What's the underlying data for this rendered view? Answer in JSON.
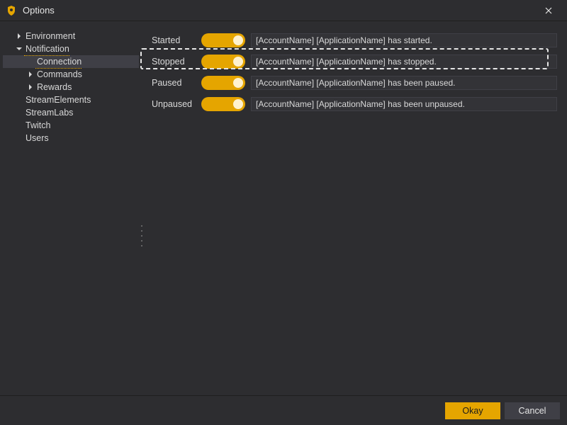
{
  "window": {
    "title": "Options"
  },
  "tree": {
    "environment": "Environment",
    "notification": "Notification",
    "connection": "Connection",
    "commands": "Commands",
    "rewards": "Rewards",
    "streamelements": "StreamElements",
    "streamlabs": "StreamLabs",
    "twitch": "Twitch",
    "users": "Users"
  },
  "rows": [
    {
      "label": "Started",
      "enabled": true,
      "text": "[AccountName] [ApplicationName] has started."
    },
    {
      "label": "Stopped",
      "enabled": true,
      "text": "[AccountName] [ApplicationName] has stopped."
    },
    {
      "label": "Paused",
      "enabled": true,
      "text": "[AccountName] [ApplicationName] has been paused."
    },
    {
      "label": "Unpaused",
      "enabled": true,
      "text": "[AccountName] [ApplicationName] has been unpaused."
    }
  ],
  "footer": {
    "ok": "Okay",
    "cancel": "Cancel"
  },
  "colors": {
    "accent": "#e5a500",
    "panel": "#2d2d30",
    "input": "#333337",
    "border": "#3f3f46"
  }
}
